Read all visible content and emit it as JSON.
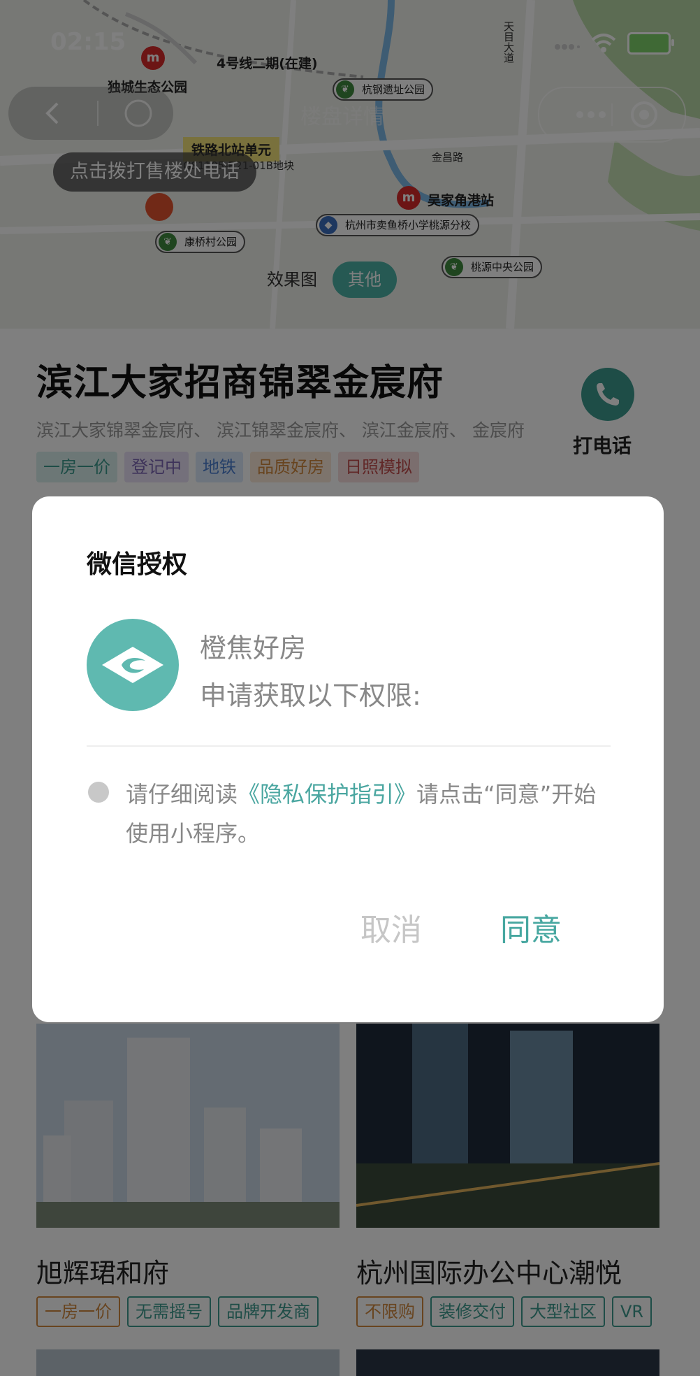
{
  "status": {
    "time": "02:15"
  },
  "nav": {
    "title": "楼盘详情"
  },
  "map": {
    "call_tip": "点击拨打售楼处电话",
    "labels": {
      "line4": "4号线二期(在建)",
      "park": "独城生态公园",
      "north_station": "铁路北站单元",
      "plot": "GS1105-R21-01B地块",
      "wujia": "吴家角港站",
      "road1": "金昌路",
      "road2": "天目大道",
      "road3": "杭钢遗址公园"
    },
    "pois": [
      "杭钢遗址公园",
      "杭州市卖鱼桥小学桃源分校",
      "康桥村公园",
      "桃源中央公园"
    ],
    "tabs": [
      {
        "label": "效果图",
        "active": false
      },
      {
        "label": "其他",
        "active": true
      }
    ]
  },
  "project": {
    "title": "滨江大家招商锦翠金宸府",
    "aliases": "滨江大家锦翠金宸府、 滨江锦翠金宸府、 滨江金宸府、 金宸府",
    "tags": [
      {
        "label": "一房一价",
        "bg": "#d8efec",
        "color": "#3c9a8e"
      },
      {
        "label": "登记中",
        "bg": "#e8e0f6",
        "color": "#7c67b4"
      },
      {
        "label": "地铁",
        "bg": "#dbe8fb",
        "color": "#4b7fd0"
      },
      {
        "label": "品质好房",
        "bg": "#fbe9d8",
        "color": "#d0883e"
      },
      {
        "label": "日照模拟",
        "bg": "#f6dcdc",
        "color": "#c24f4f"
      }
    ],
    "call_label": "打电话"
  },
  "listings": [
    {
      "name": "旭辉珺和府",
      "tags": [
        {
          "label": "一房一价",
          "color": "#d0883e"
        },
        {
          "label": "无需摇号",
          "color": "#3c9a8e"
        },
        {
          "label": "品牌开发商",
          "color": "#3c9a8e"
        }
      ]
    },
    {
      "name": "杭州国际办公中心潮悦",
      "tags": [
        {
          "label": "不限购",
          "color": "#d0883e"
        },
        {
          "label": "装修交付",
          "color": "#3c9a8e"
        },
        {
          "label": "大型社区",
          "color": "#3c9a8e"
        },
        {
          "label": "VR",
          "color": "#3c9a8e"
        }
      ]
    }
  ],
  "dialog": {
    "title": "微信授权",
    "app_name": "橙焦好房",
    "request": "申请获取以下权限:",
    "notice_before": "请仔细阅读",
    "notice_link": "《隐私保护指引》",
    "notice_after": "请点击“同意”开始使用小程序。",
    "cancel": "取消",
    "agree": "同意"
  }
}
